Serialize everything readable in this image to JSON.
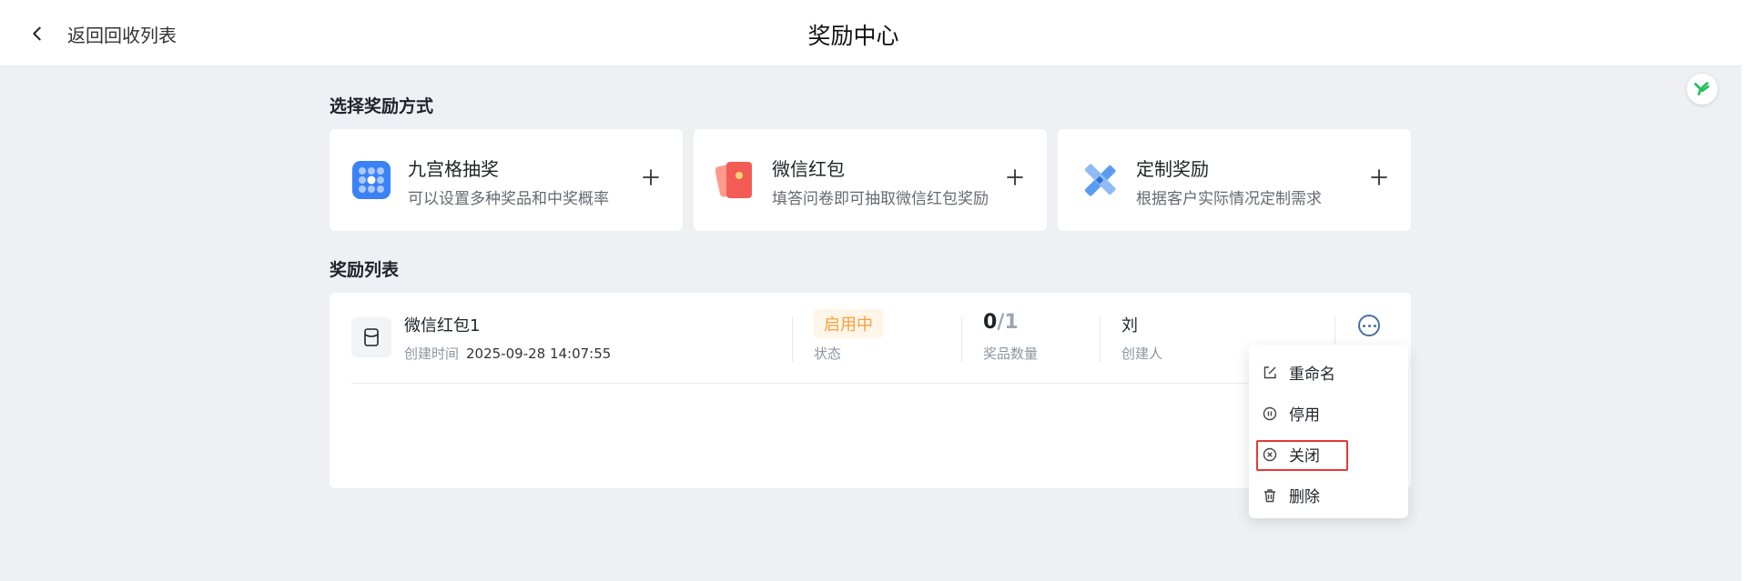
{
  "header": {
    "back_label": "返回回收列表",
    "title": "奖励中心"
  },
  "modes_section": {
    "title": "选择奖励方式",
    "cards": [
      {
        "name": "九宫格抽奖",
        "desc": "可以设置多种奖品和中奖概率",
        "icon": "grid-lottery-icon"
      },
      {
        "name": "微信红包",
        "desc": "填答问卷即可抽取微信红包奖励",
        "icon": "red-packet-icon"
      },
      {
        "name": "定制奖励",
        "desc": "根据客户实际情况定制需求",
        "icon": "custom-tools-icon"
      }
    ]
  },
  "list_section": {
    "title": "奖励列表",
    "rows": [
      {
        "name": "微信红包1",
        "created_label": "创建时间",
        "created_value": "2025-09-28 14:07:55",
        "status_value": "启用中",
        "status_label": "状态",
        "count_used": "0",
        "count_sep": "/",
        "count_total": "1",
        "count_label": "奖品数量",
        "creator_value": "刘",
        "creator_label": "创建人"
      }
    ]
  },
  "menu": {
    "items": [
      {
        "label": "重命名",
        "icon": "edit-icon"
      },
      {
        "label": "停用",
        "icon": "pause-icon"
      },
      {
        "label": "关闭",
        "icon": "close-circle-icon"
      },
      {
        "label": "删除",
        "icon": "trash-icon"
      }
    ]
  },
  "colors": {
    "accent": "#3b82f6",
    "status_text": "#f5a13c",
    "status_bg": "#fff5e8",
    "highlight_box": "#e53935",
    "background": "#eef0f4"
  }
}
